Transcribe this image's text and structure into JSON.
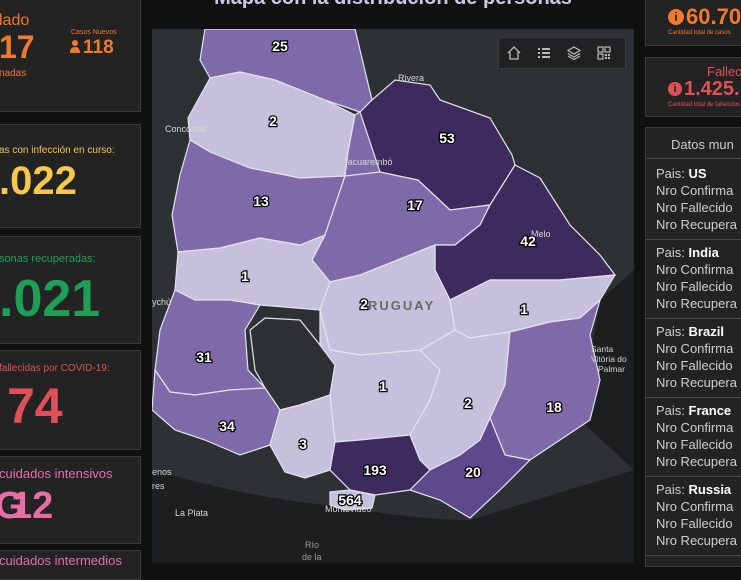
{
  "left_column": {
    "card1": {
      "label": "lado",
      "value": "17",
      "sub": "nadas",
      "new_cases_label": "Casos Nuevos",
      "new_cases_value": "118",
      "color": "#f07a2e"
    },
    "card2": {
      "label": "as con infección en curso:",
      "value": ".022",
      "color": "#f7c84e"
    },
    "card3": {
      "label": "sonas recuperadas:",
      "value": ".021",
      "color": "#1f9e57"
    },
    "card4": {
      "label": "fallecidas por COVID-19:",
      "value": "74",
      "color": "#e0505a"
    },
    "card5": {
      "label": "cuidados intensivos",
      "value": "12",
      "prefix": "G",
      "color": "#e86fa6"
    },
    "card6": {
      "label": "cuidados intermedios",
      "color": "#e86fa6"
    }
  },
  "map": {
    "title": "Mapa con la distribución de personas",
    "tools": [
      "home-icon",
      "list-icon",
      "layers-icon",
      "qr-grid-icon"
    ],
    "country_label": "RUGUAY",
    "place_labels": [
      "Rivera",
      "Concordia",
      "Tacuarembó",
      "Melo",
      "ychú",
      "Santa Vitória do Palmar",
      "enos res",
      "La Plata",
      "Montevideo",
      "Río de la"
    ],
    "department_counts": [
      "25",
      "2",
      "53",
      "13",
      "17",
      "42",
      "1",
      "2",
      "1",
      "31",
      "1",
      "34",
      "2",
      "18",
      "3",
      "193",
      "20",
      "564"
    ],
    "colors": {
      "lightest": "#c6c0dc",
      "light": "#b8b0d3",
      "medium": "#7e6aa9",
      "dark": "#5c4a8c",
      "darkest": "#3c2b5c",
      "background": "#2e3133"
    }
  },
  "right_column": {
    "card1": {
      "value": "60.70",
      "sub": "Cantidad total de casos",
      "color": "#f07a2e"
    },
    "card2": {
      "label": "Fallec",
      "value": "1.425.",
      "sub": "Cantidad total de fallecidos",
      "color": "#e0505a"
    },
    "world": {
      "title": "Datos mun",
      "countries": [
        {
          "pais_label": "Pais:",
          "name": "US",
          "rows": [
            "Nro Confirma",
            "Nro Fallecido",
            "Nro Recupera"
          ]
        },
        {
          "pais_label": "Pais:",
          "name": "India",
          "rows": [
            "Nro Confirma",
            "Nro Fallecido",
            "Nro Recupera"
          ]
        },
        {
          "pais_label": "Pais:",
          "name": "Brazil",
          "rows": [
            "Nro Confirma",
            "Nro Fallecido",
            "Nro Recupera"
          ]
        },
        {
          "pais_label": "Pais:",
          "name": "France",
          "rows": [
            "Nro Confirma",
            "Nro Fallecido",
            "Nro Recupera"
          ]
        },
        {
          "pais_label": "Pais:",
          "name": "Russia",
          "rows": [
            "Nro Confirma",
            "Nro Fallecido",
            "Nro Recupera"
          ]
        }
      ]
    }
  }
}
